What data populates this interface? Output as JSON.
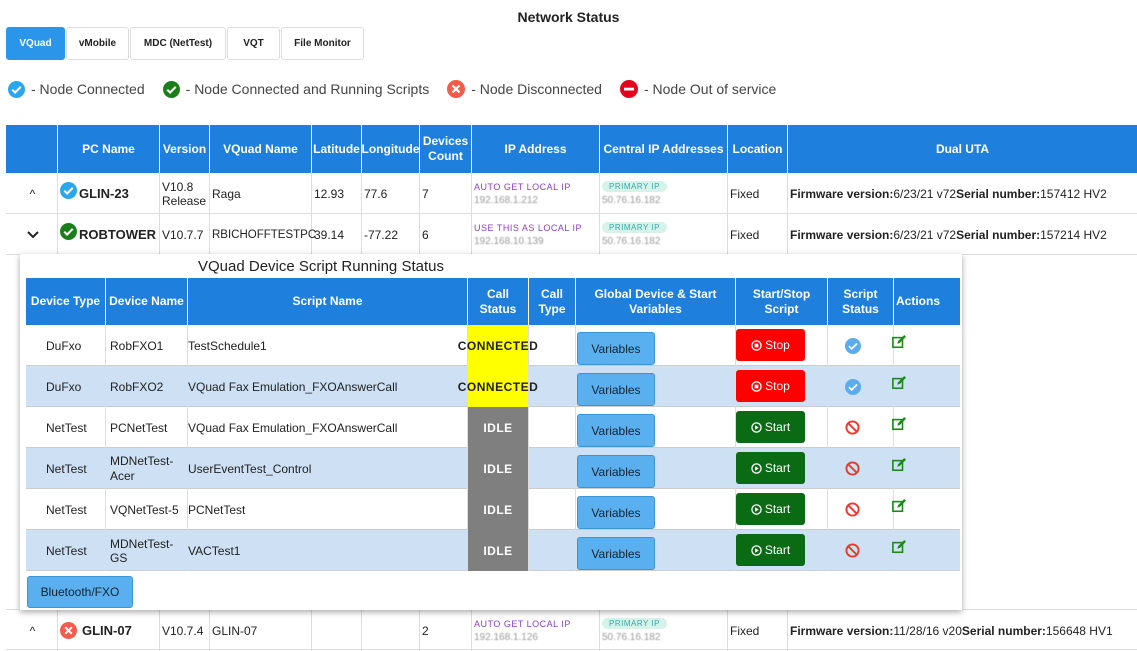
{
  "page_title": "Network Status",
  "tabs": [
    {
      "label": "VQuad",
      "active": true
    },
    {
      "label": "vMobile",
      "active": false
    },
    {
      "label": "MDC (NetTest)",
      "active": false
    },
    {
      "label": "VQT",
      "active": false
    },
    {
      "label": "File Monitor",
      "active": false
    }
  ],
  "legend": [
    {
      "icon": "check-blue-icon",
      "label": "- Node Connected"
    },
    {
      "icon": "check-green-icon",
      "label": "- Node Connected and Running Scripts"
    },
    {
      "icon": "x-orange-icon",
      "label": "- Node Disconnected"
    },
    {
      "icon": "minus-red-icon",
      "label": "- Node Out of service"
    }
  ],
  "main_table": {
    "headers": [
      "",
      "PC Name",
      "Version",
      "VQuad Name",
      "Latitude",
      "Longitude",
      "Devices Count",
      "IP Address",
      "Central IP Addresses",
      "Location",
      "Dual UTA"
    ],
    "rows": [
      {
        "chevron": "^",
        "status_icon": "check-blue-icon",
        "pc_name": "GLIN-23",
        "version": "V10.8 Release",
        "vquad_name": "Raga",
        "latitude": "12.93",
        "longitude": "77.6",
        "devices_count": "7",
        "ip_label": "AUTO GET LOCAL IP",
        "ip_value": "192.168.1.212",
        "central_label": "PRIMARY IP",
        "central_value": "50.76.16.182",
        "location": "Fixed",
        "fw_label": "Firmware version:",
        "fw_value": "6/23/21 v72",
        "sn_label": "Serial number:",
        "sn_value": "157412 HV2"
      },
      {
        "chevron": "v",
        "status_icon": "check-green-icon",
        "pc_name": "ROBTOWER",
        "version": "V10.7.7",
        "vquad_name": "RBICHOFFTESTPC",
        "latitude": "39.14",
        "longitude": "-77.22",
        "devices_count": "6",
        "ip_label": "USE THIS AS LOCAL IP",
        "ip_value": "192.168.10.139",
        "central_label": "PRIMARY IP",
        "central_value": "50.76.16.182",
        "location": "Fixed",
        "fw_label": "Firmware version:",
        "fw_value": "6/23/21 v72",
        "sn_label": "Serial number:",
        "sn_value": "157214 HV2"
      },
      {
        "chevron": "^",
        "status_icon": "x-orange-icon",
        "pc_name": "GLIN-07",
        "version": "V10.7.4",
        "vquad_name": "GLIN-07",
        "latitude": "",
        "longitude": "",
        "devices_count": "2",
        "ip_label": "AUTO GET LOCAL IP",
        "ip_value": "192.168.1.126",
        "central_label": "PRIMARY IP",
        "central_value": "50.76.16.182",
        "location": "Fixed",
        "fw_label": "Firmware version:",
        "fw_value": "11/28/16 v20",
        "sn_label": "Serial number:",
        "sn_value": "156648 HV1"
      }
    ]
  },
  "panel": {
    "title": "VQuad Device Script Running Status",
    "headers": [
      "Device Type",
      "Device Name",
      "Script Name",
      "Call Status",
      "Call Type",
      "Global Device & Start Variables",
      "Start/Stop Script",
      "Script Status",
      "Actions"
    ],
    "rows": [
      {
        "type": "DuFxo",
        "name": "RobFXO1",
        "script": "TestSchedule1",
        "call_status": "CONNECTED",
        "call_type": "",
        "variables": "Variables",
        "action": "Stop",
        "script_status_icon": "check-blue-icon",
        "edit_icon": "edit-icon"
      },
      {
        "type": "DuFxo",
        "name": "RobFXO2",
        "script": "VQuad Fax Emulation_FXOAnswerCall",
        "call_status": "CONNECTED",
        "call_type": "",
        "variables": "Variables",
        "action": "Stop",
        "script_status_icon": "check-blue-icon",
        "edit_icon": "edit-icon"
      },
      {
        "type": "NetTest",
        "name": "PCNetTest",
        "script": "VQuad Fax Emulation_FXOAnswerCall",
        "call_status": "IDLE",
        "call_type": "",
        "variables": "Variables",
        "action": "Start",
        "script_status_icon": "not-allowed-icon",
        "edit_icon": "edit-icon"
      },
      {
        "type": "NetTest",
        "name": "MDNetTest-Acer",
        "script": "UserEventTest_Control",
        "call_status": "IDLE",
        "call_type": "",
        "variables": "Variables",
        "action": "Start",
        "script_status_icon": "not-allowed-icon",
        "edit_icon": "edit-icon"
      },
      {
        "type": "NetTest",
        "name": "VQNetTest-5",
        "script": "PCNetTest",
        "call_status": "IDLE",
        "call_type": "",
        "variables": "Variables",
        "action": "Start",
        "script_status_icon": "not-allowed-icon",
        "edit_icon": "edit-icon"
      },
      {
        "type": "NetTest",
        "name": "MDNetTest-GS",
        "script": "VACTest1",
        "call_status": "IDLE",
        "call_type": "",
        "variables": "Variables",
        "action": "Start",
        "script_status_icon": "not-allowed-icon",
        "edit_icon": "edit-icon"
      }
    ],
    "bottom_button": "Bluetooth/FXO"
  },
  "colors": {
    "header_blue": "#1e7fdc",
    "connected_yellow": "#ffff00",
    "idle_gray": "#7f7f7f",
    "stop_red": "#ff0000",
    "start_green": "#0b6b14"
  }
}
